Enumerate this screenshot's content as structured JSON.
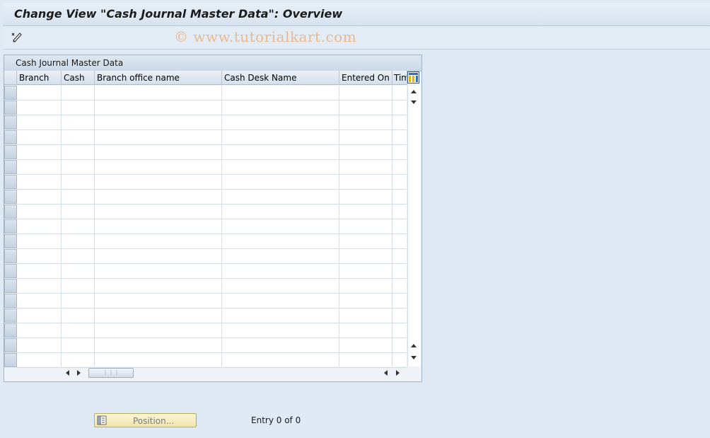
{
  "window": {
    "title": "Change View \"Cash Journal Master Data\": Overview"
  },
  "watermark": "© www.tutorialkart.com",
  "toolbar": {
    "buttons": [
      {
        "icon": "display-change-pencil-icon"
      }
    ]
  },
  "panel": {
    "title": "Cash Journal Master Data"
  },
  "table": {
    "columns": [
      {
        "label": "Branch"
      },
      {
        "label": "Cash"
      },
      {
        "label": "Branch office name"
      },
      {
        "label": "Cash Desk Name"
      },
      {
        "label": "Entered On"
      },
      {
        "label": "Tim"
      }
    ],
    "visible_rows": 19,
    "rows": []
  },
  "footer": {
    "position_button_label": "Position...",
    "entry_text": "Entry 0 of 0"
  },
  "colors": {
    "background": "#dfe9f3",
    "watermark": "#e8b98f",
    "position_button": "#f1e5aa"
  }
}
